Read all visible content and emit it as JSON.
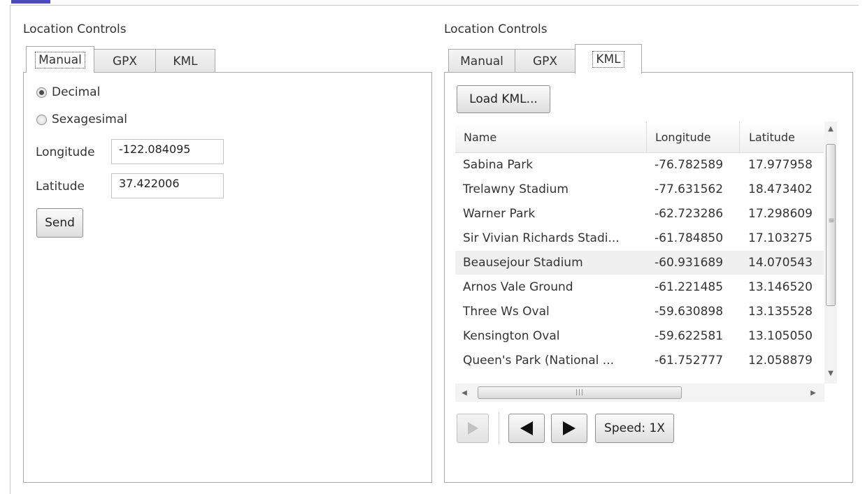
{
  "left": {
    "section_label": "Location Controls",
    "tabs": [
      "Manual",
      "GPX",
      "KML"
    ],
    "radio_options": [
      {
        "label": "Decimal",
        "checked": true
      },
      {
        "label": "Sexagesimal",
        "checked": false
      }
    ],
    "longitude_label": "Longitude",
    "longitude_value": "-122.084095",
    "latitude_label": "Latitude",
    "latitude_value": "37.422006",
    "send_label": "Send"
  },
  "right": {
    "section_label": "Location Controls",
    "tabs": [
      "Manual",
      "GPX",
      "KML"
    ],
    "load_button": "Load KML...",
    "columns": [
      "Name",
      "Longitude",
      "Latitude"
    ],
    "rows": [
      {
        "name": "Sabina Park",
        "longitude": "-76.782589",
        "latitude": "17.977958"
      },
      {
        "name": "Trelawny Stadium",
        "longitude": "-77.631562",
        "latitude": "18.473402"
      },
      {
        "name": "Warner Park",
        "longitude": "-62.723286",
        "latitude": "17.298609"
      },
      {
        "name": "Sir Vivian Richards Stadi...",
        "longitude": "-61.784850",
        "latitude": "17.103275"
      },
      {
        "name": "Beausejour Stadium",
        "longitude": "-60.931689",
        "latitude": "14.070543"
      },
      {
        "name": "Arnos Vale Ground",
        "longitude": "-61.221485",
        "latitude": "13.146520"
      },
      {
        "name": "Three Ws Oval",
        "longitude": "-59.630898",
        "latitude": "13.135528"
      },
      {
        "name": "Kensington Oval",
        "longitude": "-59.622581",
        "latitude": "13.105050"
      },
      {
        "name": "Queen's Park (National ...",
        "longitude": "-61.752777",
        "latitude": "12.058879"
      }
    ],
    "selected_row": 4,
    "speed_label": "Speed: 1X"
  },
  "colors": {
    "accent": "#4a4ab8",
    "border": "#a9a9a9",
    "selected_row": "#f0f0f0"
  }
}
